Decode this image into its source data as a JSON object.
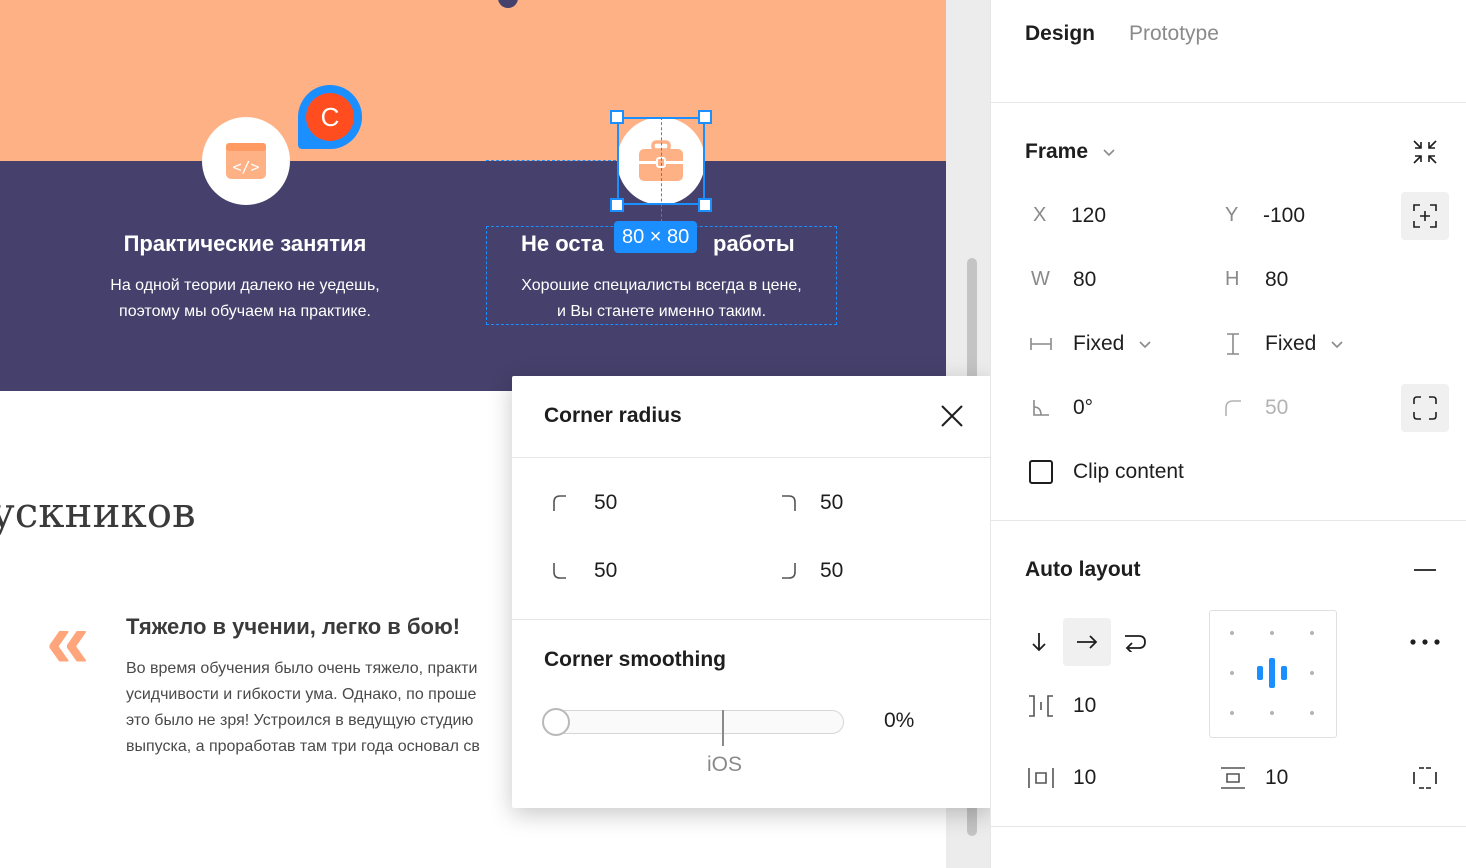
{
  "canvas": {
    "features": [
      {
        "title": "Практические занятия",
        "text_line1": "На одной теории далеко не уедешь,",
        "text_line2": "поэтому мы обучаем на практике."
      },
      {
        "title_left": "Не оста",
        "title_right": "работы",
        "text_line1": "Хорошие специалисты всегда в цене,",
        "text_line2": "и Вы станете именно таким."
      }
    ],
    "size_badge": "80 × 80",
    "avatar_letter": "C",
    "section_heading": "ускников",
    "review": {
      "quote_glyph": "«",
      "title": "Тяжело в учении, легко в бою!",
      "lines": [
        "Во время обучения было очень тяжело, практи",
        "усидчивости и гибкости ума. Однако, по проше",
        "это было не зря! Устроился в ведущую студию",
        "выпуска, а проработав там три года основал св"
      ]
    },
    "colors": {
      "peach": "#ffb186",
      "dark": "#46416c",
      "selection": "#1b8fff"
    }
  },
  "popup": {
    "title": "Corner radius",
    "corners": {
      "top_left": "50",
      "top_right": "50",
      "bottom_left": "50",
      "bottom_right": "50"
    },
    "smoothing_title": "Corner smoothing",
    "smoothing_value": "0%",
    "ios_label": "iOS",
    "smoothing_fraction": 0
  },
  "panel": {
    "tabs": [
      "Design",
      "Prototype"
    ],
    "frame": {
      "title": "Frame",
      "x_label": "X",
      "x_value": "120",
      "y_label": "Y",
      "y_value": "-100",
      "w_label": "W",
      "w_value": "80",
      "h_label": "H",
      "h_value": "80",
      "width_mode": "Fixed",
      "height_mode": "Fixed",
      "rotation": "0°",
      "radius": "50",
      "clip_content": "Clip content"
    },
    "auto_layout": {
      "title": "Auto layout",
      "spacing": "10",
      "padding_h": "10",
      "padding_v": "10"
    }
  }
}
